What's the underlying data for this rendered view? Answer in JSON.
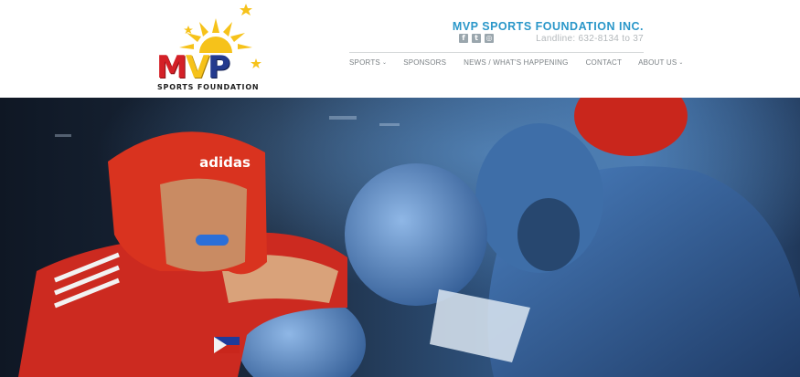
{
  "logo": {
    "letters": {
      "m": "M",
      "v": "V",
      "p": "P"
    },
    "tagline": "SPORTS FOUNDATION"
  },
  "header": {
    "org_name": "MVP SPORTS FOUNDATION INC.",
    "landline": "Landline: 632-8134 to 37",
    "social_icons": [
      "facebook-icon",
      "twitter-icon",
      "instagram-icon"
    ]
  },
  "nav": {
    "items": [
      {
        "label": "SPORTS",
        "has_dropdown": true
      },
      {
        "label": "SPONSORS",
        "has_dropdown": false
      },
      {
        "label": "NEWS / WHAT'S HAPPENING",
        "has_dropdown": false
      },
      {
        "label": "CONTACT",
        "has_dropdown": false
      },
      {
        "label": "ABOUT US",
        "has_dropdown": true
      }
    ]
  },
  "hero": {
    "headgear_brand": "adidas"
  },
  "colors": {
    "brand_blue": "#2a97c9",
    "logo_red": "#d42027",
    "logo_yellow": "#f6c21a",
    "logo_navy": "#233a8e",
    "nav_text": "#7b8185"
  }
}
